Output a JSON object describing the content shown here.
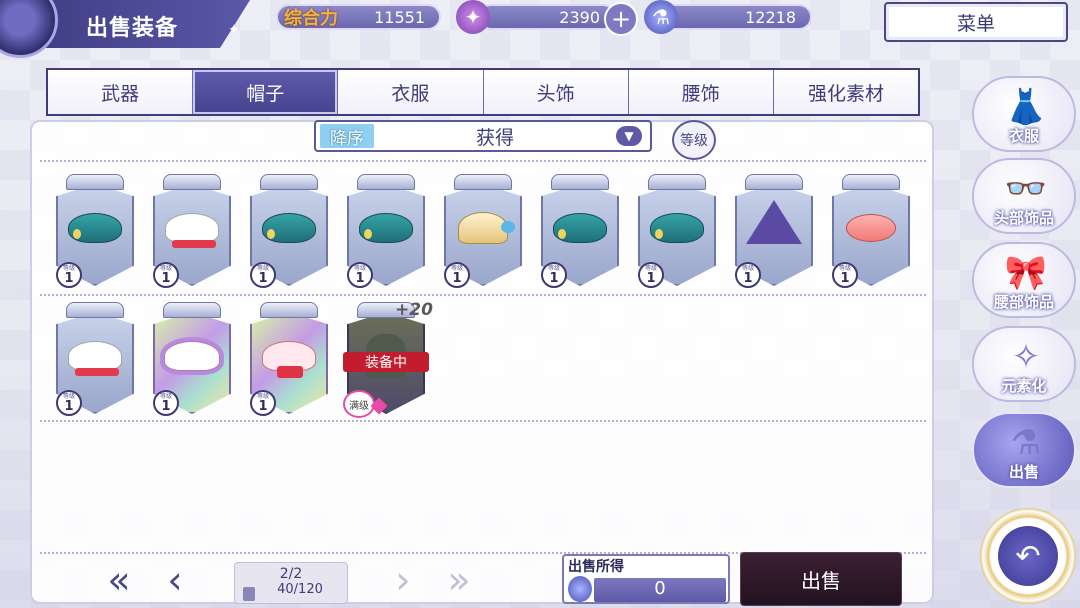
{
  "header": {
    "title": "出售装备",
    "power_label": "综合力",
    "power_value": "11551",
    "star_value": "2390",
    "plus_symbol": "+",
    "potion_value": "12218",
    "menu_label": "菜单"
  },
  "tabs": [
    {
      "label": "武器",
      "active": false
    },
    {
      "label": "帽子",
      "active": true
    },
    {
      "label": "衣服",
      "active": false
    },
    {
      "label": "头饰",
      "active": false
    },
    {
      "label": "腰饰",
      "active": false
    },
    {
      "label": "强化素材",
      "active": false
    }
  ],
  "sort": {
    "order_label": "降序",
    "value": "获得",
    "level_button": "等级"
  },
  "items": [
    {
      "icon": "teal-beret",
      "level_label": "等级",
      "level": "1"
    },
    {
      "icon": "white-sailor-cap",
      "level_label": "等级",
      "level": "1"
    },
    {
      "icon": "teal-beret",
      "level_label": "等级",
      "level": "1"
    },
    {
      "icon": "teal-beret",
      "level_label": "等级",
      "level": "1"
    },
    {
      "icon": "shell-headpiece",
      "level_label": "等级",
      "level": "1"
    },
    {
      "icon": "teal-beret",
      "level_label": "等级",
      "level": "1"
    },
    {
      "icon": "teal-beret",
      "level_label": "等级",
      "level": "1"
    },
    {
      "icon": "witch-hat",
      "level_label": "等级",
      "level": "1"
    },
    {
      "icon": "pink-hat",
      "level_label": "等级",
      "level": "1"
    },
    {
      "icon": "white-sailor-cap",
      "level_label": "等级",
      "level": "1"
    },
    {
      "icon": "frilled-cap",
      "rarity": "rare",
      "level_label": "等级",
      "level": "1"
    },
    {
      "icon": "red-bow-cap",
      "rarity": "rare",
      "level_label": "等级",
      "level": "1"
    },
    {
      "icon": "equipped-hat",
      "equipped": true,
      "equipped_label": "装备中",
      "plus": "+20",
      "level_label": "等级",
      "max_label": "满级"
    }
  ],
  "side_nav": [
    {
      "label": "衣服",
      "icon": "dress-icon",
      "active": false
    },
    {
      "label": "头部饰品",
      "icon": "glasses-icon",
      "active": false
    },
    {
      "label": "腰部饰品",
      "icon": "bow-icon",
      "active": false
    },
    {
      "label": "元素化",
      "icon": "element-icon",
      "active": false
    },
    {
      "label": "出售",
      "icon": "potion-icon",
      "active": true
    }
  ],
  "pagination": {
    "page": "2/2",
    "count": "40/120"
  },
  "footer": {
    "earn_label": "出售所得",
    "earn_value": "0",
    "sell_button": "出售"
  },
  "colors": {
    "accent": "#45428e",
    "equipped_tag": "#c21d2f",
    "sell_button": "#24121f"
  }
}
